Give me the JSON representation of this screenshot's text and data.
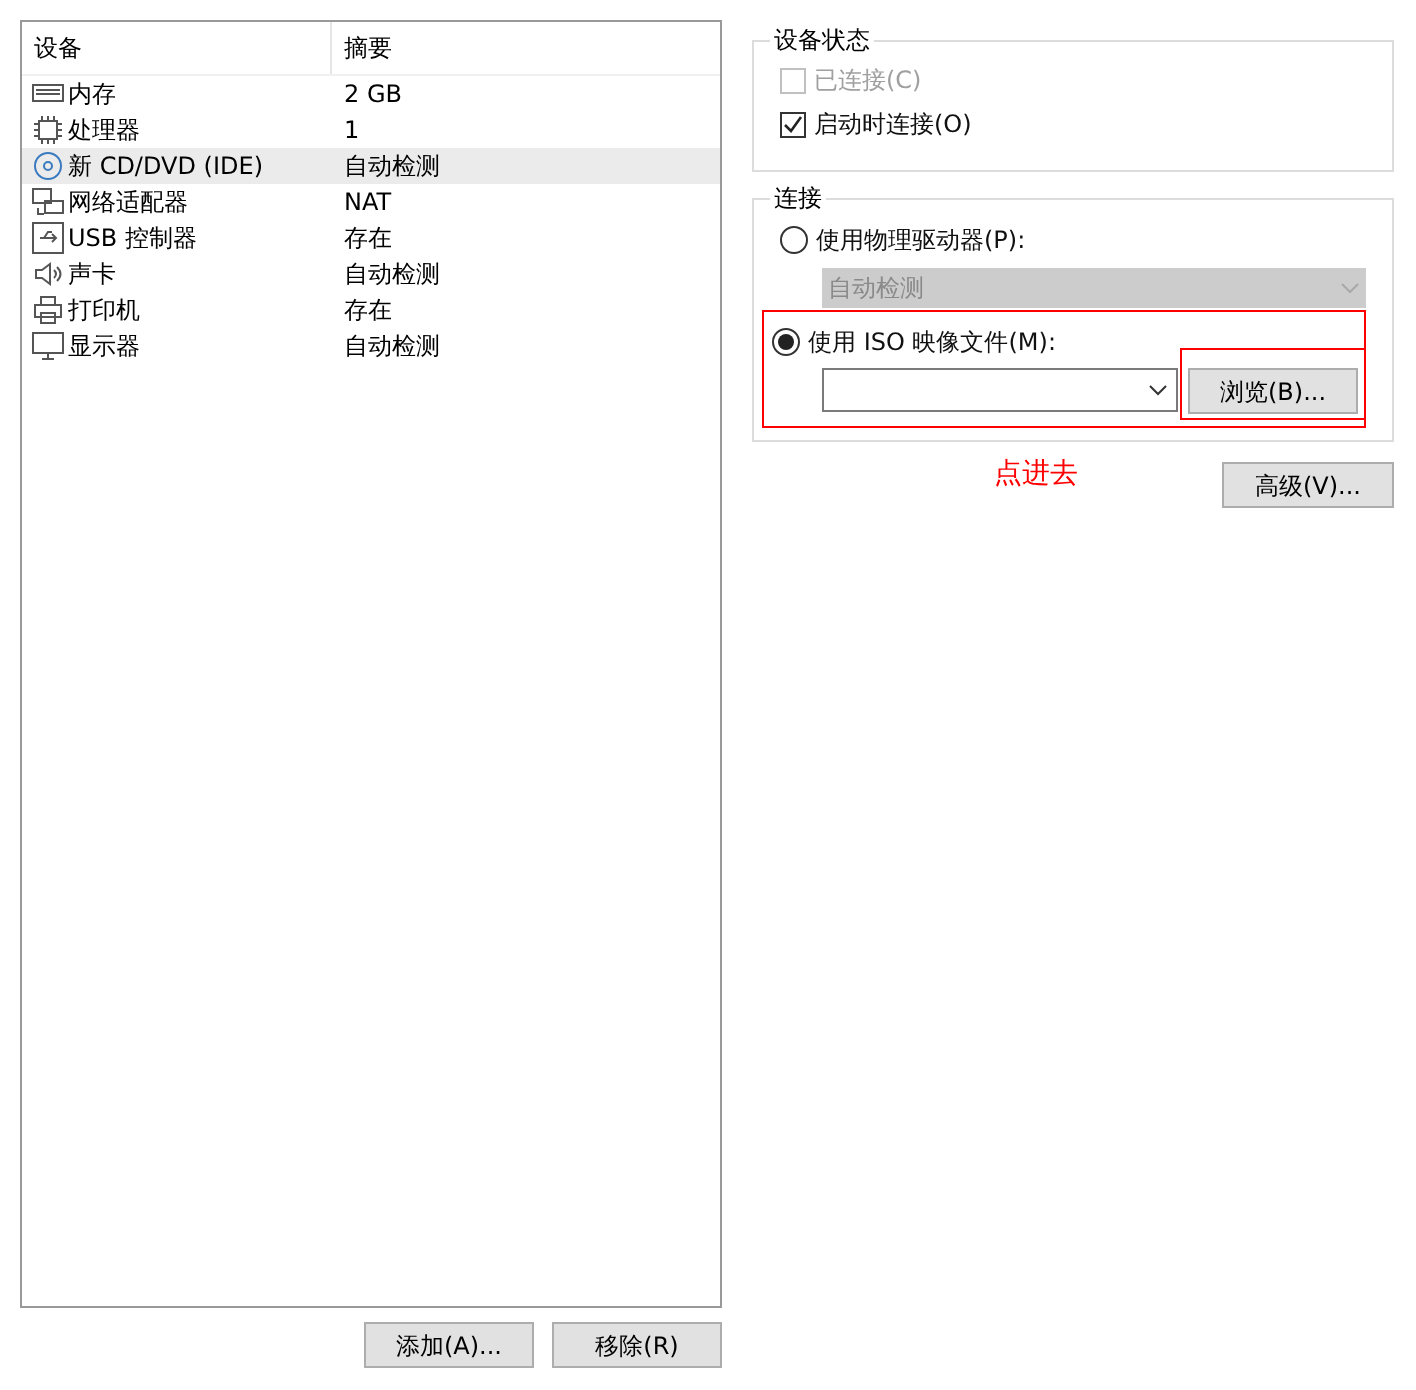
{
  "devices": {
    "columns": [
      "设备",
      "摘要"
    ],
    "rows": [
      {
        "kind": "memory",
        "name": "内存",
        "summary": "2 GB",
        "selected": false
      },
      {
        "kind": "cpu",
        "name": "处理器",
        "summary": "1",
        "selected": false
      },
      {
        "kind": "disc",
        "name": "新 CD/DVD (IDE)",
        "summary": "自动检测",
        "selected": true
      },
      {
        "kind": "network",
        "name": "网络适配器",
        "summary": "NAT",
        "selected": false
      },
      {
        "kind": "usb",
        "name": "USB 控制器",
        "summary": "存在",
        "selected": false
      },
      {
        "kind": "sound",
        "name": "声卡",
        "summary": "自动检测",
        "selected": false
      },
      {
        "kind": "printer",
        "name": "打印机",
        "summary": "存在",
        "selected": false
      },
      {
        "kind": "display",
        "name": "显示器",
        "summary": "自动检测",
        "selected": false
      }
    ]
  },
  "device_status": {
    "title": "设备状态",
    "items": [
      {
        "label": "已连接(C)",
        "checked": false,
        "disabled": true
      },
      {
        "label": "启动时连接(O)",
        "checked": true,
        "disabled": false
      }
    ]
  },
  "connection": {
    "title": "连接",
    "physical": {
      "label": "使用物理驱动器(P):",
      "selected": false,
      "drive_value": "自动检测",
      "disabled": true
    },
    "iso": {
      "label": "使用 ISO 映像文件(M):",
      "selected": true,
      "browse_button": "浏览(B)..."
    }
  },
  "annotation": "点进去",
  "advanced_button": "高级(V)...",
  "buttons": [
    "添加(A)...",
    "移除(R)"
  ]
}
